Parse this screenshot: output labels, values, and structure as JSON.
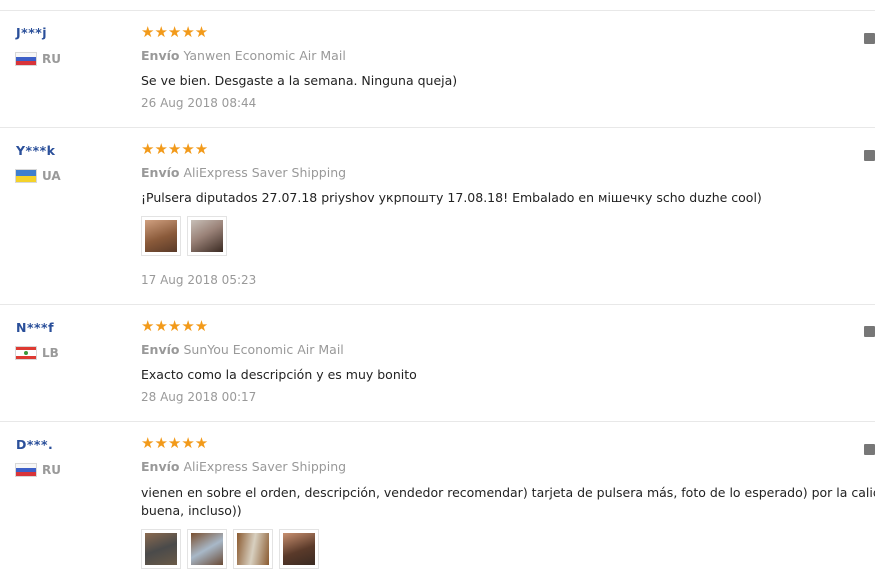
{
  "reviews": [
    {
      "user": "J***j",
      "country": "RU",
      "stars": "★★★★★",
      "shipping_label": "Envío",
      "shipping_method": "Yanwen Economic Air Mail",
      "feedback_lines": [
        "Se ve bien. Desgaste a la semana. Ninguna queja)"
      ],
      "date": "26 Aug 2018 08:44"
    },
    {
      "user": "Y***k",
      "country": "UA",
      "stars": "★★★★★",
      "shipping_label": "Envío",
      "shipping_method": "AliExpress Saver Shipping",
      "feedback_lines": [
        "¡Pulsera diputados 27.07.18 priyshov укрпошту 17.08.18! Embalado en мішечку scho duzhe cool)"
      ],
      "date": "17 Aug 2018 05:23",
      "photo_colors": [
        "#8a5a3a",
        "#6b4a3a"
      ]
    },
    {
      "user": "N***f",
      "country": "LB",
      "stars": "★★★★★",
      "shipping_label": "Envío",
      "shipping_method": "SunYou Economic Air Mail",
      "feedback_lines": [
        "Exacto como la descripción y es muy bonito"
      ],
      "date": "28 Aug 2018 00:17"
    },
    {
      "user": "D***.",
      "country": "RU",
      "stars": "★★★★★",
      "shipping_label": "Envío",
      "shipping_method": "AliExpress Saver Shipping",
      "feedback_lines": [
        "vienen en sobre el orden, descripción, vendedor recomendar) tarjeta de pulsera más, foto de lo esperado) por la calidad es muy",
        "buena, incluso))"
      ],
      "photo_colors": [
        "#4a4a4a",
        "#6a4a35",
        "#8a5a30",
        "#5a3a2a"
      ]
    }
  ],
  "colors": {
    "username": "#2a4f9a",
    "star": "#f29a1a",
    "muted": "#999999"
  }
}
